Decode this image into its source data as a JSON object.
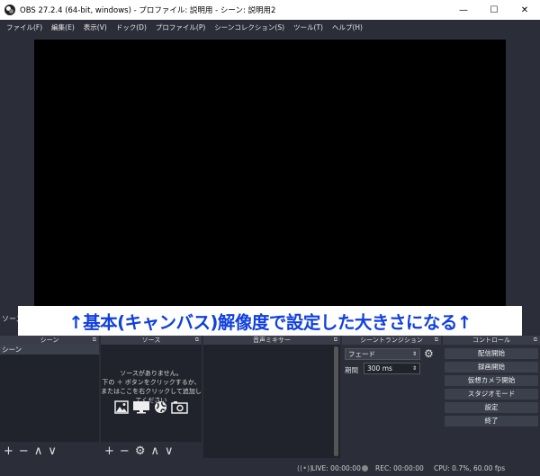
{
  "window": {
    "title": "OBS 27.2.4 (64-bit, windows) - プロファイル: 説明用 - シーン: 説明用2",
    "minimize": "—",
    "maximize": "☐",
    "close": "✕"
  },
  "menu": [
    "ファイル(F)",
    "編集(E)",
    "表示(V)",
    "ドック(D)",
    "プロファイル(P)",
    "シーンコレクション(S)",
    "ツール(T)",
    "ヘルプ(H)"
  ],
  "banner": "↑基本(キャンバス)解像度で設定した大きさになる↑",
  "sources_tab": "ソース",
  "docks": {
    "scenes": {
      "title": "シーン",
      "items": [
        "シーン"
      ]
    },
    "sources": {
      "title": "ソース",
      "empty_line1": "ソースがありません。",
      "empty_line2": "下の ＋ ボタンをクリックするか、",
      "empty_line3": "またはここを右クリックして追加してください"
    },
    "mixer": {
      "title": "音声ミキサー"
    },
    "transitions": {
      "title": "シーントランジション",
      "selected": "フェード",
      "duration_label": "期間",
      "duration_value": "300 ms"
    },
    "controls": {
      "title": "コントロール",
      "buttons": [
        "配信開始",
        "録画開始",
        "仮想カメラ開始",
        "スタジオモード",
        "設定",
        "終了"
      ]
    }
  },
  "toolbar": {
    "add": "+",
    "remove": "−",
    "up": "∧",
    "down": "∨",
    "settings": "⚙"
  },
  "status": {
    "live": "LIVE: 00:00:00",
    "rec": "REC: 00:00:00",
    "cpu": "CPU: 0.7%, 60.00 fps"
  }
}
